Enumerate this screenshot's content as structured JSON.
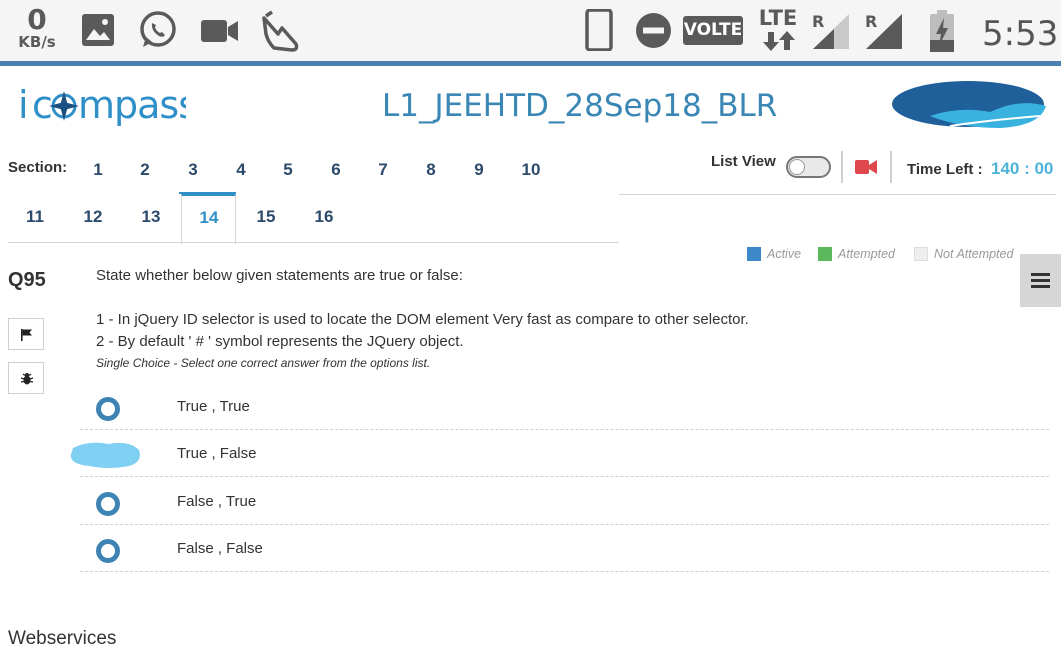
{
  "status_bar": {
    "speed_value": "0",
    "speed_unit": "KB/s",
    "network_badge": "VOLTE",
    "network_type": "LTE",
    "roaming_1": "R",
    "roaming_2": "R",
    "time": "5:53",
    "icons": [
      "gallery-icon",
      "whatsapp-icon",
      "video-camera-icon",
      "hand-icon",
      "phone-portrait-icon",
      "do-not-disturb-icon",
      "volte-icon",
      "lte-icon",
      "signal-icon",
      "battery-charging-icon"
    ]
  },
  "header": {
    "logo_text": "icompass",
    "exam_title": "L1_JEEHTD_28Sep18_BLR"
  },
  "sections": {
    "label": "Section:",
    "tabs": [
      "1",
      "2",
      "3",
      "4",
      "5",
      "6",
      "7",
      "8",
      "9",
      "10",
      "11",
      "12",
      "13",
      "14",
      "15",
      "16"
    ],
    "active": "14"
  },
  "toolbar": {
    "list_view_label": "List View",
    "time_left_label": "Time Left :",
    "time_left_value": "140 : 00",
    "accent_color": "#2f8fc8",
    "camera_color": "#e0474c"
  },
  "legend": {
    "active": "Active",
    "attempted": "Attempted",
    "not_attempted": "Not Attempted",
    "active_color": "#3d88c9",
    "attempted_color": "#5cb85c",
    "not_attempted_color": "#eeeeee"
  },
  "question": {
    "number": "Q95",
    "intro": "State whether below given statements are true or false:",
    "statement_1": "1 - In jQuery ID selector is used to locate the DOM element Very fast as compare to other selector.",
    "statement_2": "2 - By default ' # ' symbol represents the JQuery object.",
    "hint": "Single Choice - Select one correct answer from the options list.",
    "options": [
      "True , True",
      "True , False",
      "False , True",
      "False , False"
    ]
  },
  "footer": {
    "text": "Webservices"
  }
}
